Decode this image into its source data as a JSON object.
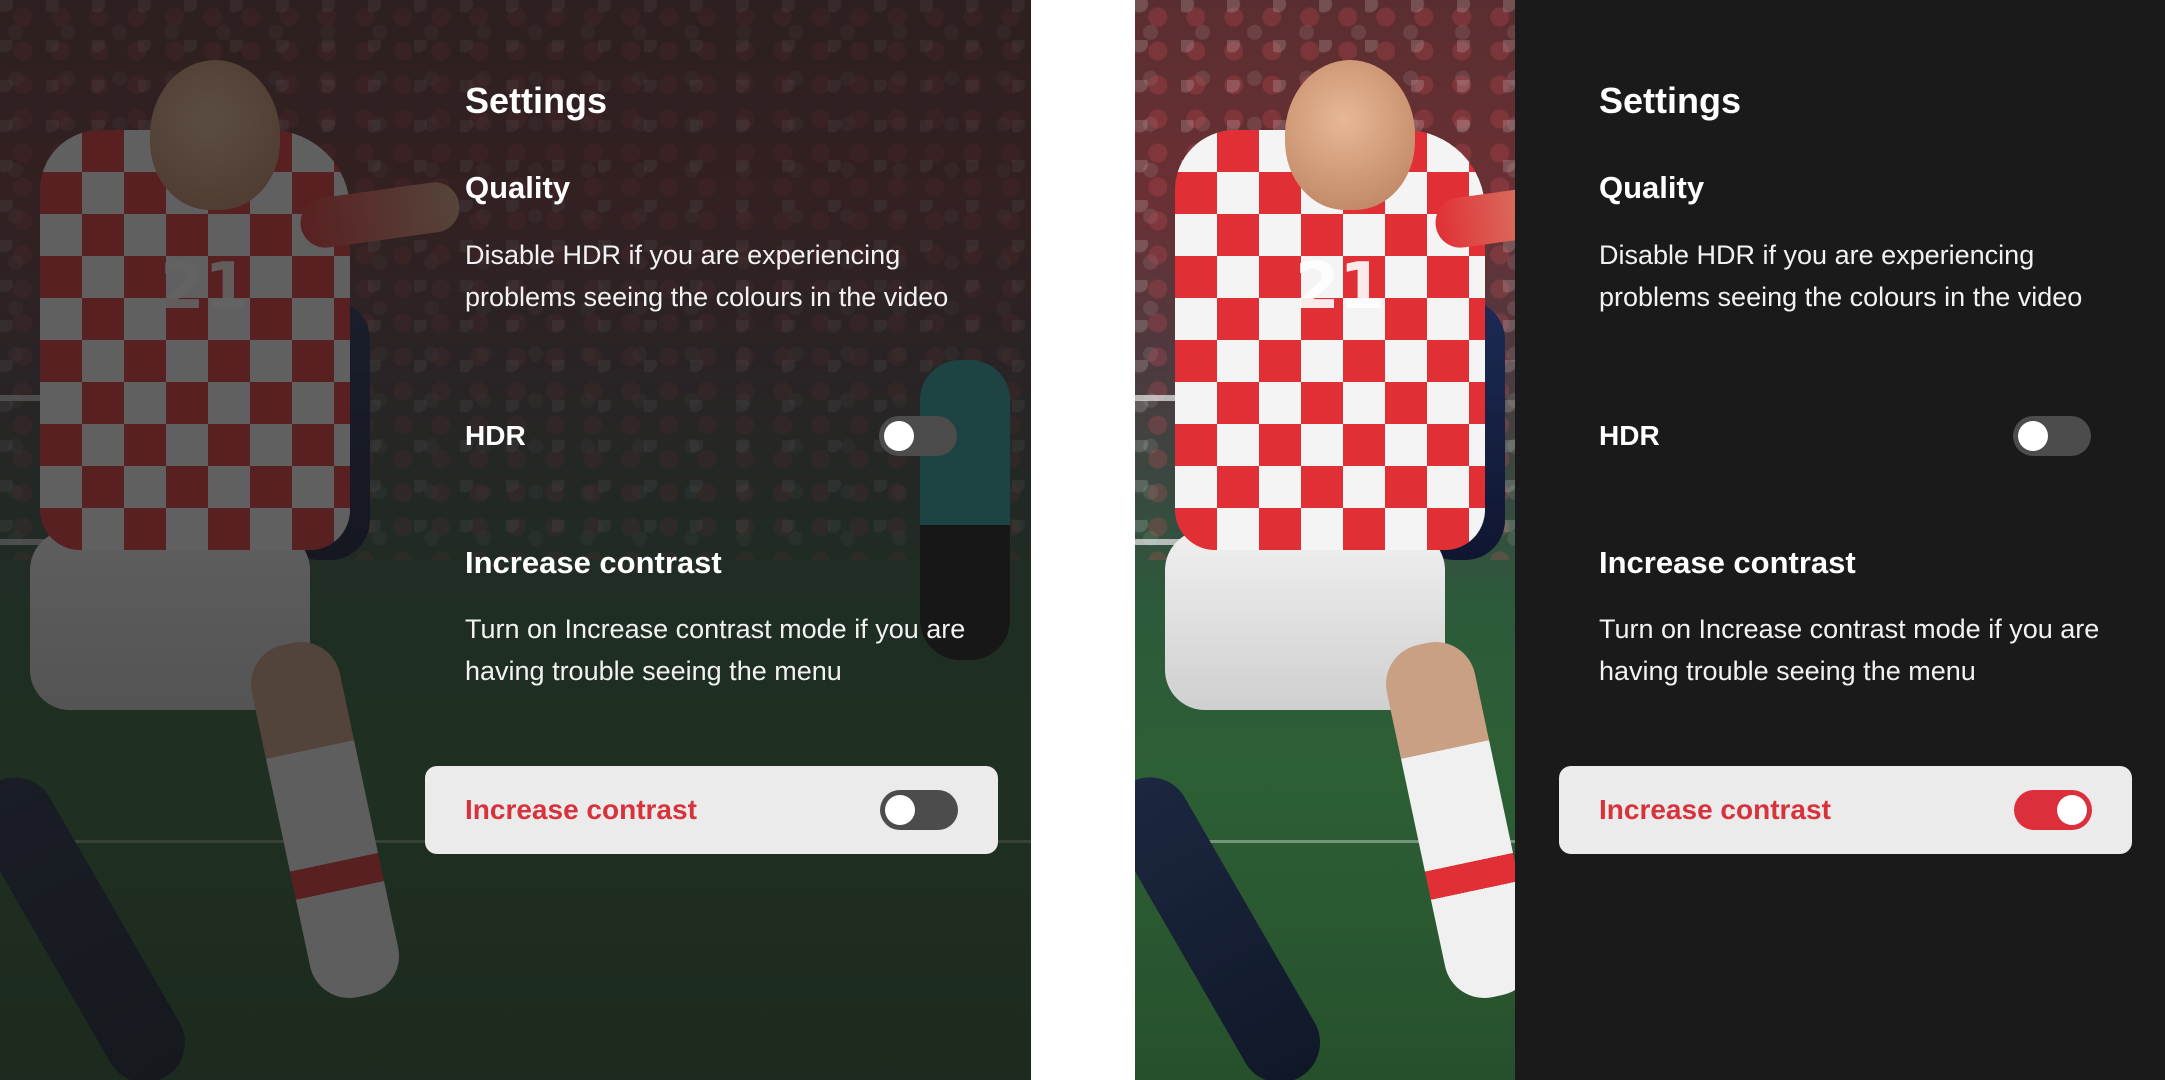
{
  "colors": {
    "accent_red": "#dd2e3c",
    "label_red": "#d7333c",
    "panel_dark": "#1b1a1b",
    "toggle_off": "#4c4c4c",
    "row_background": "#ebebeb"
  },
  "panels": [
    {
      "variant": "overlay",
      "settings": {
        "title": "Settings",
        "quality": {
          "heading": "Quality",
          "description": "Disable HDR if you are experiencing problems seeing the colours in the video",
          "hdr_label": "HDR",
          "hdr_on": false
        },
        "contrast": {
          "heading": "Increase contrast",
          "description": "Turn on Increase contrast mode if you are having trouble seeing the menu",
          "toggle_label": "Increase contrast",
          "toggle_on": false
        }
      }
    },
    {
      "variant": "solid",
      "settings": {
        "title": "Settings",
        "quality": {
          "heading": "Quality",
          "description": "Disable HDR if you are experiencing problems seeing the colours in the video",
          "hdr_label": "HDR",
          "hdr_on": false
        },
        "contrast": {
          "heading": "Increase contrast",
          "description": "Turn on Increase contrast mode if you are having trouble seeing the menu",
          "toggle_label": "Increase contrast",
          "toggle_on": true
        }
      }
    }
  ]
}
